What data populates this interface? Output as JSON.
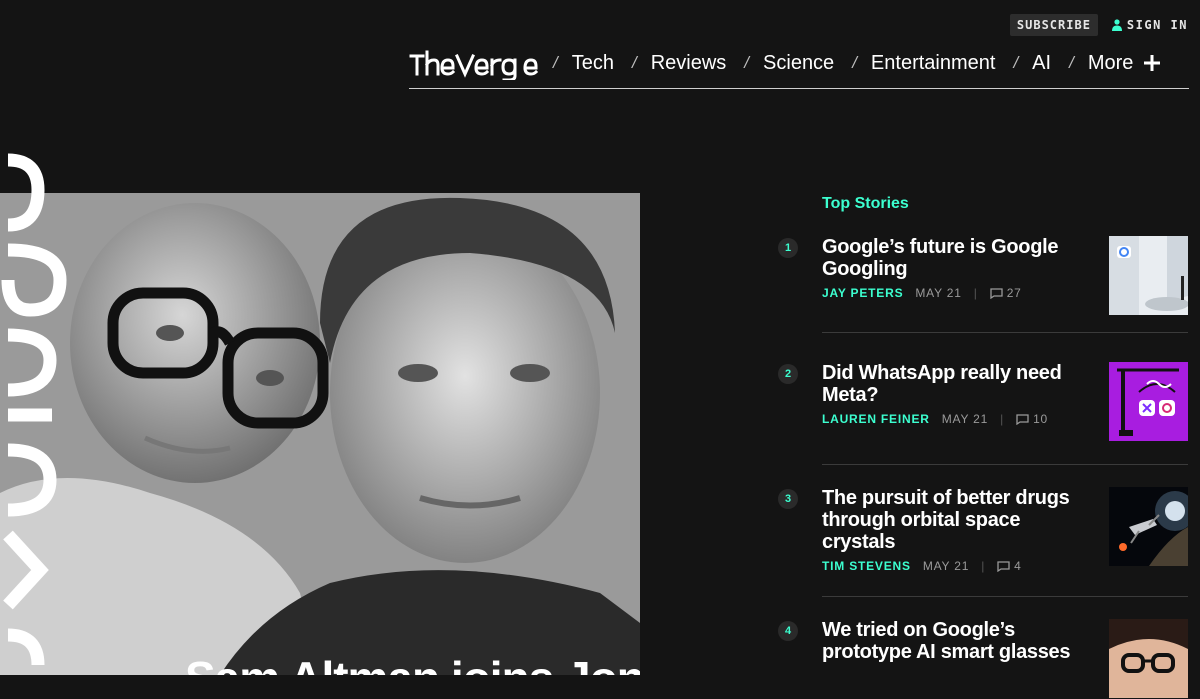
{
  "header": {
    "subscribe": "SUBSCRIBE",
    "signin": "SIGN IN",
    "logo_text": "The Verge",
    "nav": [
      "Tech",
      "Reviews",
      "Science",
      "Entertainment",
      "AI",
      "More"
    ]
  },
  "hero": {
    "headline_partial": "Sam Altman joins Jony Ive"
  },
  "top_stories": {
    "title": "Top Stories",
    "items": [
      {
        "num": "1",
        "title": "Google’s future is Google Googling",
        "author": "JAY PETERS",
        "date": "MAY 21",
        "comments": "27"
      },
      {
        "num": "2",
        "title": "Did WhatsApp really need Meta?",
        "author": "LAUREN FEINER",
        "date": "MAY 21",
        "comments": "10"
      },
      {
        "num": "3",
        "title": "The pursuit of better drugs through orbital space crystals",
        "author": "TIM STEVENS",
        "date": "MAY 21",
        "comments": "4"
      },
      {
        "num": "4",
        "title": "We tried on Google’s prototype AI smart glasses",
        "author": "",
        "date": "",
        "comments": ""
      }
    ]
  },
  "colors": {
    "accent": "#3cffd0",
    "background": "#141414",
    "story_thumb_2": "#a81de0"
  },
  "icons": {
    "signin": "person-icon",
    "more": "plus-icon",
    "comments": "comment-bubble-icon"
  }
}
